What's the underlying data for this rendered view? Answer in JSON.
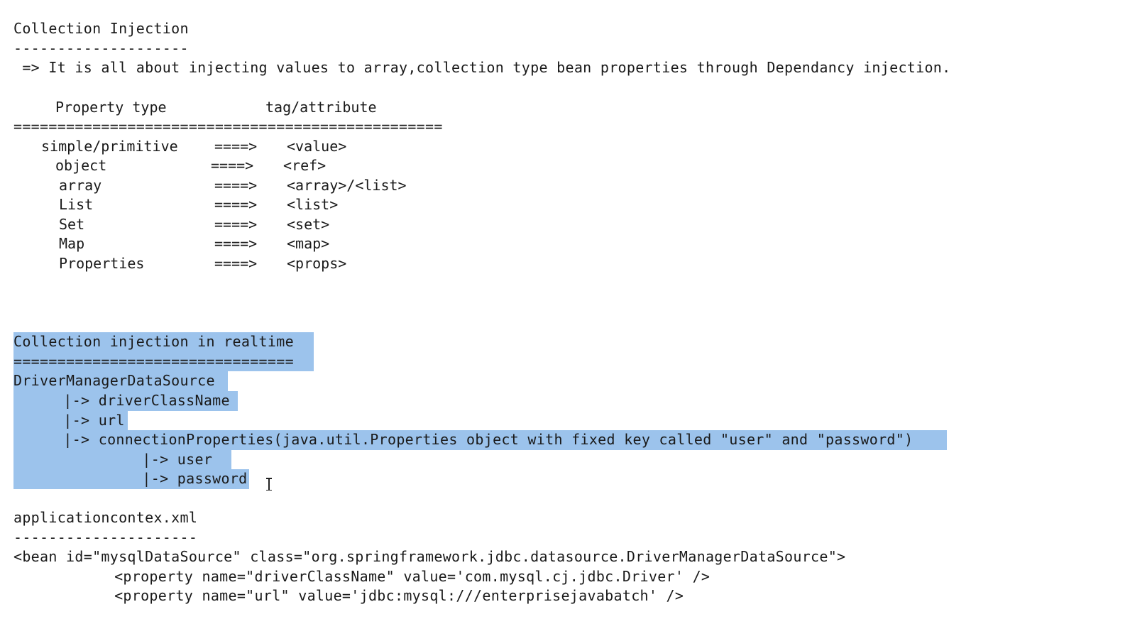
{
  "heading1": {
    "title": "Collection Injection",
    "underline": "--------------------",
    "description": " => It is all about injecting values to array,collection type bean properties through Dependancy injection."
  },
  "table": {
    "header_type": "Property type",
    "header_tag": "tag/attribute",
    "separator": "=================================================",
    "rows": [
      {
        "type": "simple/primitive",
        "arrow": "====>",
        "tag": "<value>"
      },
      {
        "type": "object",
        "arrow": "====>",
        "tag": "<ref>"
      },
      {
        "type": "array",
        "arrow": "====>",
        "tag": "<array>/<list>"
      },
      {
        "type": "List",
        "arrow": "====>",
        "tag": "<list>"
      },
      {
        "type": "Set",
        "arrow": "====>",
        "tag": "<set>"
      },
      {
        "type": "Map",
        "arrow": "====>",
        "tag": "<map>"
      },
      {
        "type": "Properties",
        "arrow": "====>",
        "tag": "<props>"
      }
    ]
  },
  "realtime": {
    "title": "Collection injection in realtime",
    "separator": "================================",
    "root": "DriverManagerDataSource",
    "children": [
      "    |-> driverClassName ",
      "    |-> url ",
      "    |-> connectionProperties(java.util.Properties object with fixed key called \"user\" and \"password\") "
    ],
    "grandchildren": [
      "             |-> user ",
      "             |-> password"
    ]
  },
  "appcontext": {
    "filename": "applicationcontex.xml",
    "underline": "---------------------",
    "bean_line": "<bean id=\"mysqlDataSource\" class=\"org.springframework.jdbc.datasource.DriverManagerDataSource\">",
    "prop1": "         <property name=\"driverClassName\" value='com.mysql.cj.jdbc.Driver' />",
    "prop2": "         <property name=\"url\" value='jdbc:mysql:///enterprisejavabatch' />"
  },
  "colors": {
    "selection": "#9cc3ec",
    "text": "#1a1a1a",
    "background": "#ffffff"
  }
}
